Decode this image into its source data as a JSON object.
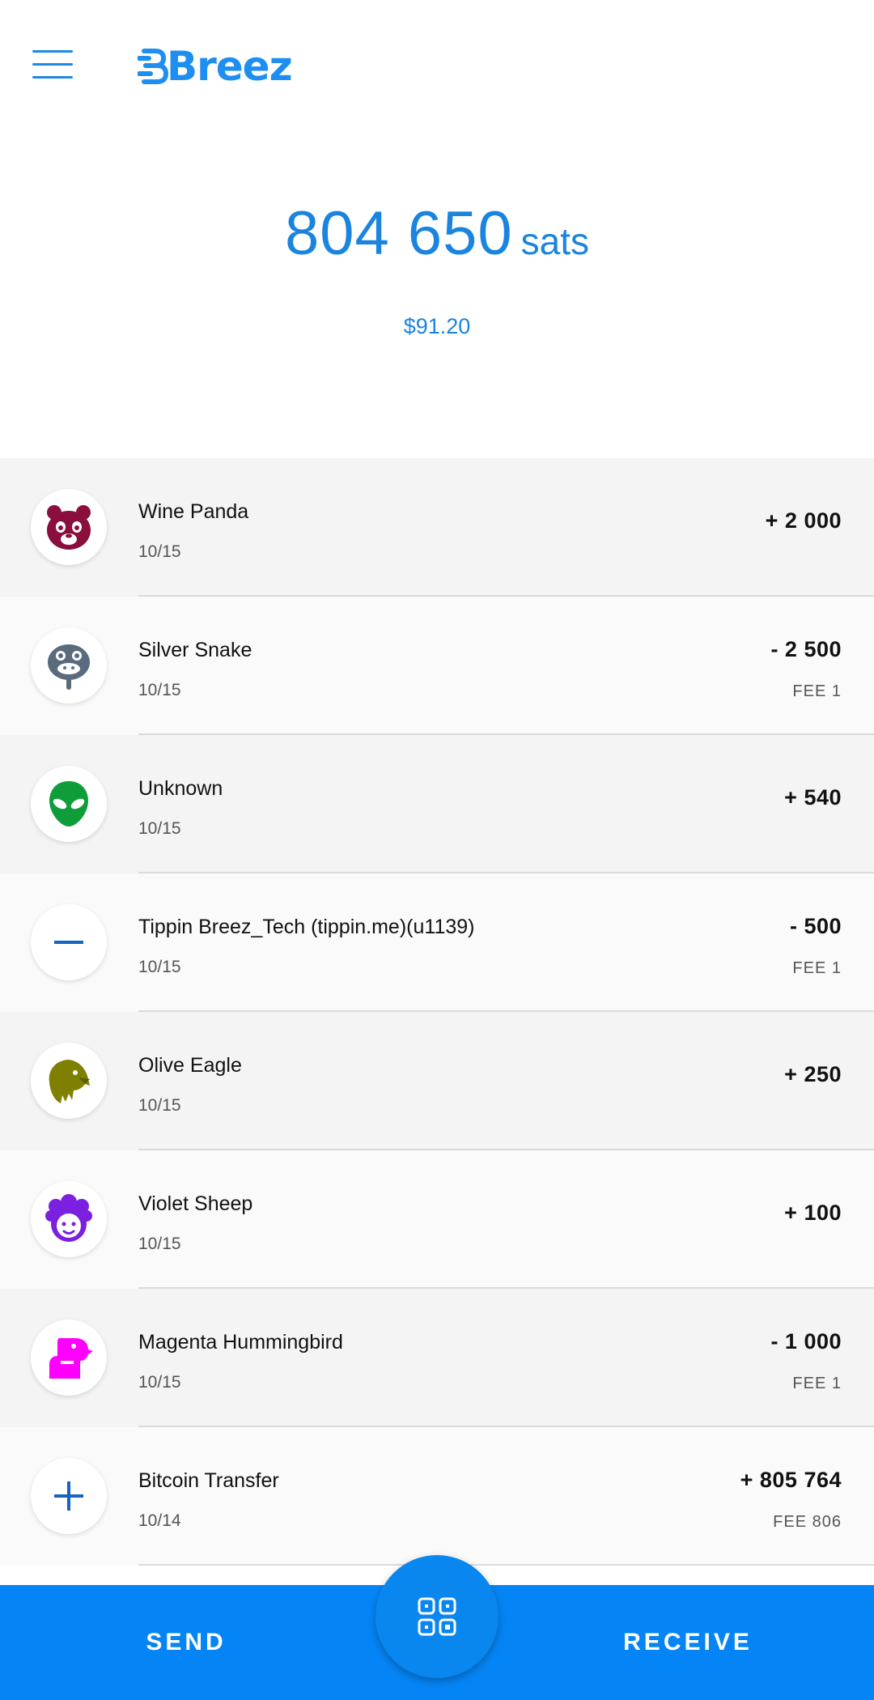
{
  "header": {
    "menu_icon": "hamburger-menu-icon",
    "logo_text": "Breez",
    "brand_color": "#1e8ff0"
  },
  "balance": {
    "amount": "804 650",
    "unit": "sats",
    "fiat": "$91.20"
  },
  "transactions": [
    {
      "title": "Wine Panda",
      "date": "10/15",
      "amount": "+ 2 000",
      "fee": "",
      "icon": "panda-icon",
      "icon_color": "#8b0f3c"
    },
    {
      "title": "Silver Snake",
      "date": "10/15",
      "amount": "- 2 500",
      "fee": "FEE 1",
      "icon": "snake-icon",
      "icon_color": "#5a6b7d"
    },
    {
      "title": "Unknown",
      "date": "10/15",
      "amount": "+ 540",
      "fee": "",
      "icon": "alien-icon",
      "icon_color": "#0f9d3a"
    },
    {
      "title": "Tippin Breez_Tech (tippin.me)(u1139)",
      "date": "10/15",
      "amount": "- 500",
      "fee": "FEE 1",
      "icon": "minus-icon",
      "icon_color": "#1565c0"
    },
    {
      "title": "Olive Eagle",
      "date": "10/15",
      "amount": "+ 250",
      "fee": "",
      "icon": "eagle-icon",
      "icon_color": "#808000"
    },
    {
      "title": "Violet Sheep",
      "date": "10/15",
      "amount": "+ 100",
      "fee": "",
      "icon": "sheep-icon",
      "icon_color": "#7b1fe0"
    },
    {
      "title": "Magenta Hummingbird",
      "date": "10/15",
      "amount": "- 1 000",
      "fee": "FEE 1",
      "icon": "hummingbird-icon",
      "icon_color": "#ff00ff"
    },
    {
      "title": "Bitcoin Transfer",
      "date": "10/14",
      "amount": "+ 805 764",
      "fee": "FEE 806",
      "icon": "plus-icon",
      "icon_color": "#1565c0"
    }
  ],
  "bottom_bar": {
    "send_label": "SEND",
    "receive_label": "RECEIVE",
    "scan_icon": "qr-scan-icon",
    "accent": "#0585f5"
  }
}
